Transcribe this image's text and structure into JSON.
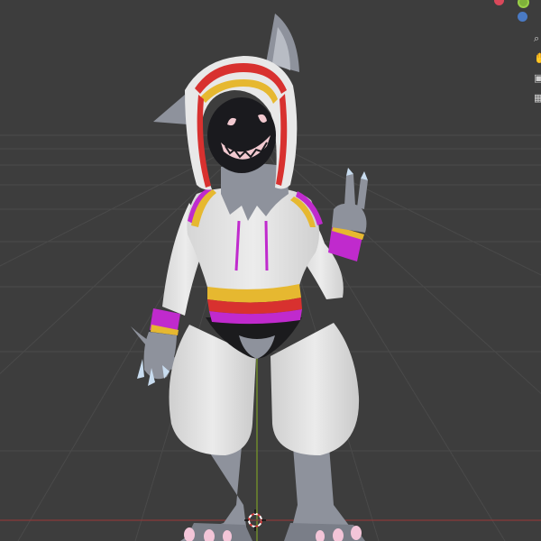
{
  "viewport": {
    "background": "#3d3d3d",
    "grid_color": "#4a4a4a",
    "axis_color_y": "#6f8a2c",
    "axis_color_x": "#8a3a3a"
  },
  "gizmo": {
    "axes": [
      {
        "name": "x-axis",
        "color": "#d9485a"
      },
      {
        "name": "y-axis",
        "color": "#7fb23a"
      },
      {
        "name": "z-axis",
        "color": "#4a7ac4"
      }
    ]
  },
  "model": {
    "colors": {
      "fur": "#8e929c",
      "fur_dark": "#6b6f79",
      "hoodie": "#e8e8e8",
      "hoodie_shade": "#cfcfcf",
      "face": "#1a1a1e",
      "mouth": "#f2c9d0",
      "stripe_red": "#d8312f",
      "stripe_yellow": "#e6b830",
      "stripe_magenta": "#c02acd",
      "claw": "#c8dcef",
      "toe_pad": "#f3c5d8"
    }
  },
  "cursor_icon": "3d-cursor-icon"
}
